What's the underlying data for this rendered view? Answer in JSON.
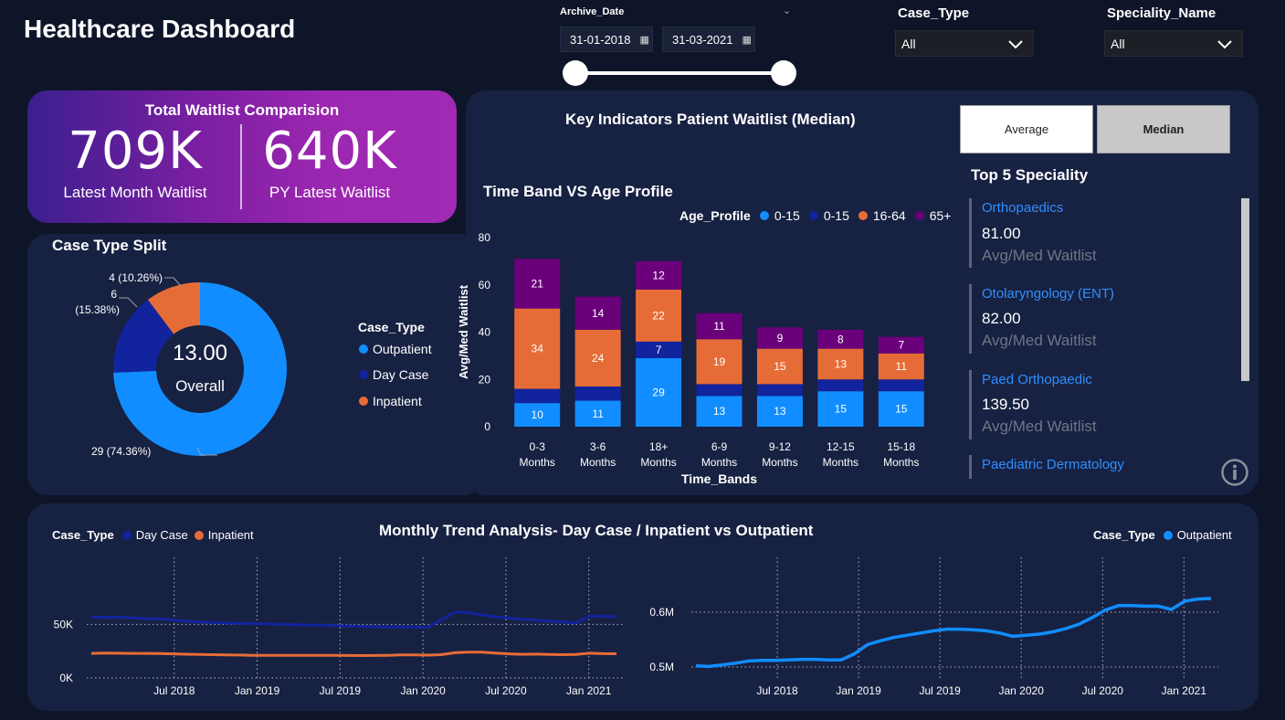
{
  "header": {
    "title": "Healthcare Dashboard"
  },
  "filters": {
    "archive_label": "Archive_Date",
    "date_from": "31-01-2018",
    "date_to": "31-03-2021",
    "case_type_label": "Case_Type",
    "case_type_value": "All",
    "speciality_label": "Speciality_Name",
    "speciality_value": "All",
    "slider_start_fraction": 0,
    "slider_end_fraction": 1
  },
  "kpi": {
    "title": "Total Waitlist Comparision",
    "latest_value": "709K",
    "latest_label": "Latest Month Waitlist",
    "py_value": "640K",
    "py_label": "PY Latest Waitlist"
  },
  "case_split": {
    "title": "Case Type Split",
    "center_value": "13.00",
    "center_label": "Overall",
    "legend_title": "Case_Type",
    "legend": [
      {
        "label": "Outpatient",
        "color": "#118dff"
      },
      {
        "label": "Day Case",
        "color": "#12239e"
      },
      {
        "label": "Inpatient",
        "color": "#e66c37"
      }
    ]
  },
  "key_indicators": {
    "title": "Key Indicators Patient Waitlist (Median)",
    "btn_average": "Average",
    "btn_median": "Median",
    "bar_title": "Time Band VS Age Profile",
    "legend_title": "Age_Profile",
    "legend": [
      {
        "label": "0-15",
        "color": "#118dff"
      },
      {
        "label": "0-15",
        "color": "#12239e"
      },
      {
        "label": "16-64",
        "color": "#e66c37"
      },
      {
        "label": "65+",
        "color": "#6b007b"
      }
    ]
  },
  "top_speciality": {
    "title": "Top 5 Speciality",
    "items": [
      {
        "name": "Orthopaedics",
        "value": "81.00",
        "sub": "Avg/Med Waitlist"
      },
      {
        "name": "Otolaryngology (ENT)",
        "value": "82.00",
        "sub": "Avg/Med Waitlist"
      },
      {
        "name": "Paed Orthopaedic",
        "value": "139.50",
        "sub": "Avg/Med Waitlist"
      },
      {
        "name": "Paediatric Dermatology",
        "value": "",
        "sub": ""
      }
    ]
  },
  "trend": {
    "title": "Monthly Trend Analysis- Day Case / Inpatient vs Outpatient",
    "left_legend_title": "Case_Type",
    "left_legend": [
      {
        "label": "Day Case",
        "color": "#12239e"
      },
      {
        "label": "Inpatient",
        "color": "#e66c37"
      }
    ],
    "right_legend_title": "Case_Type",
    "right_legend": [
      {
        "label": "Outpatient",
        "color": "#118dff"
      }
    ]
  },
  "chart_data": [
    {
      "type": "pie",
      "categories": [
        "Outpatient",
        "Day Case",
        "Inpatient"
      ],
      "values": [
        29,
        6,
        4
      ],
      "data_labels": [
        "29 (74.36%)",
        "6 (15.38%)",
        "4 (10.26%)"
      ],
      "colors": [
        "#118dff",
        "#12239e",
        "#e66c37"
      ]
    },
    {
      "type": "bar",
      "title": "Time Band VS Age Profile",
      "xlabel": "Time_Bands",
      "ylabel": "Avg/Med Waitlist",
      "ylim": [
        0,
        80
      ],
      "yticks": [
        0,
        20,
        40,
        60,
        80
      ],
      "categories": [
        "0-3 Months",
        "3-6 Months",
        "18+ Months",
        "6-9 Months",
        "9-12 Months",
        "12-15 Months",
        "15-18 Months"
      ],
      "stacked": true,
      "series": [
        {
          "name": "0-15",
          "color": "#118dff",
          "values": [
            10,
            11,
            29,
            13,
            13,
            15,
            15
          ],
          "labels": [
            "10",
            "11",
            "29",
            "13",
            "13",
            "15",
            "15"
          ]
        },
        {
          "name": "0-15",
          "color": "#12239e",
          "values": [
            6,
            6,
            7,
            5,
            5,
            5,
            5
          ],
          "labels": [
            "",
            "",
            "7",
            "",
            "",
            "",
            ""
          ]
        },
        {
          "name": "16-64",
          "color": "#e66c37",
          "values": [
            34,
            24,
            22,
            19,
            15,
            13,
            11
          ],
          "labels": [
            "34",
            "24",
            "22",
            "19",
            "15",
            "13",
            "11"
          ]
        },
        {
          "name": "65+",
          "color": "#6b007b",
          "values": [
            21,
            14,
            12,
            11,
            9,
            8,
            7
          ],
          "labels": [
            "21",
            "14",
            "12",
            "11",
            "9",
            "8",
            "7"
          ]
        }
      ]
    },
    {
      "type": "line",
      "title": "Monthly Trend Analysis- Day Case / Inpatient vs Outpatient",
      "ylim": [
        0,
        70000
      ],
      "yticks": [
        {
          "v": 0,
          "label": "0K"
        },
        {
          "v": 50000,
          "label": "50K"
        }
      ],
      "x_start": "2018-01",
      "x_end": "2021-03",
      "xticks": [
        "Jul 2018",
        "Jan 2019",
        "Jul 2019",
        "Jan 2020",
        "Jul 2020",
        "Jan 2021"
      ],
      "series": [
        {
          "name": "Day Case",
          "color": "#12239e",
          "values": [
            57000,
            56500,
            56800,
            56200,
            55500,
            55200,
            54200,
            53200,
            52300,
            51800,
            51300,
            51000,
            50800,
            50500,
            50200,
            49800,
            49500,
            49300,
            49000,
            48600,
            48200,
            47900,
            47700,
            47600,
            47500,
            47400,
            54500,
            61500,
            61300,
            59000,
            57200,
            56000,
            54800,
            54000,
            53000,
            52500,
            51500,
            57800,
            57600,
            57300
          ]
        },
        {
          "name": "Inpatient",
          "color": "#e66c37",
          "values": [
            23000,
            23200,
            23100,
            23000,
            23000,
            22800,
            22500,
            22200,
            22000,
            21800,
            21500,
            21400,
            21200,
            21200,
            21100,
            21100,
            21200,
            21200,
            21100,
            21000,
            20900,
            21000,
            21200,
            21500,
            21600,
            21300,
            21800,
            23600,
            24200,
            24100,
            23200,
            22500,
            22100,
            22300,
            22000,
            21800,
            21900,
            23100,
            22700,
            22600
          ]
        }
      ]
    },
    {
      "type": "line",
      "ylim": [
        0.48,
        0.69
      ],
      "yticks": [
        {
          "v": 0.5,
          "label": "0.5M"
        },
        {
          "v": 0.6,
          "label": "0.6M"
        }
      ],
      "x_start": "2018-01",
      "x_end": "2021-03",
      "xticks": [
        "Jul 2018",
        "Jan 2019",
        "Jul 2019",
        "Jan 2020",
        "Jul 2020",
        "Jan 2021"
      ],
      "series": [
        {
          "name": "Outpatient",
          "color": "#118dff",
          "values": [
            0.502,
            0.501,
            0.504,
            0.507,
            0.511,
            0.512,
            0.512,
            0.513,
            0.514,
            0.514,
            0.513,
            0.513,
            0.524,
            0.541,
            0.548,
            0.554,
            0.558,
            0.562,
            0.566,
            0.569,
            0.569,
            0.568,
            0.566,
            0.562,
            0.556,
            0.558,
            0.56,
            0.564,
            0.57,
            0.578,
            0.59,
            0.604,
            0.612,
            0.612,
            0.611,
            0.611,
            0.605,
            0.62,
            0.624,
            0.625
          ]
        }
      ]
    }
  ]
}
